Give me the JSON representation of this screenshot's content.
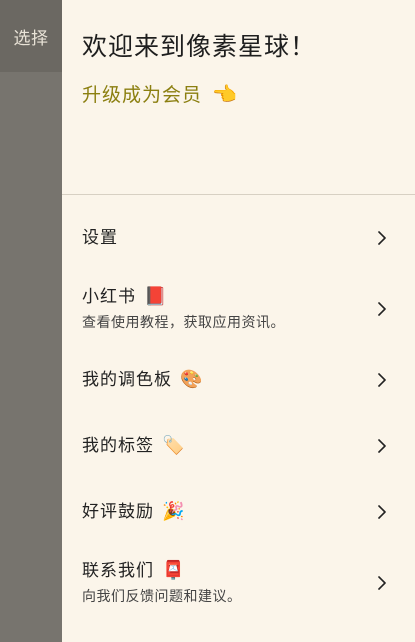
{
  "left_tab": {
    "label": "选择"
  },
  "header": {
    "welcome": "欢迎来到像素星球！",
    "upgrade": "升级成为会员",
    "upgrade_icon": "pointing-hand-emoji"
  },
  "menu": [
    {
      "title": "设置",
      "subtitle": "",
      "icon": ""
    },
    {
      "title": "小红书",
      "subtitle": "查看使用教程，获取应用资讯。",
      "icon": "book-emoji"
    },
    {
      "title": "我的调色板",
      "subtitle": "",
      "icon": "palette-emoji"
    },
    {
      "title": "我的标签",
      "subtitle": "",
      "icon": "tag-emoji"
    },
    {
      "title": "好评鼓励",
      "subtitle": "",
      "icon": "party-emoji"
    },
    {
      "title": "联系我们",
      "subtitle": "向我们反馈问题和建议。",
      "icon": "mailbox-emoji"
    }
  ],
  "colors": {
    "drawer_bg": "#fbf5ea",
    "left_bg": "#77746e",
    "upgrade": "#8b7f10",
    "text": "#222222"
  }
}
